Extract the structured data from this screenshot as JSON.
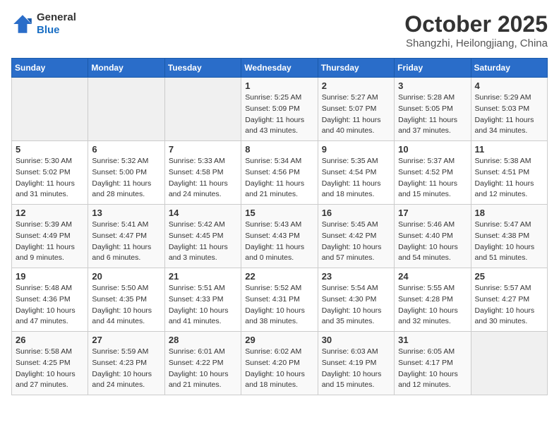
{
  "header": {
    "logo_line1": "General",
    "logo_line2": "Blue",
    "month": "October 2025",
    "location": "Shangzhi, Heilongjiang, China"
  },
  "weekdays": [
    "Sunday",
    "Monday",
    "Tuesday",
    "Wednesday",
    "Thursday",
    "Friday",
    "Saturday"
  ],
  "weeks": [
    [
      {
        "day": "",
        "info": ""
      },
      {
        "day": "",
        "info": ""
      },
      {
        "day": "",
        "info": ""
      },
      {
        "day": "1",
        "info": "Sunrise: 5:25 AM\nSunset: 5:09 PM\nDaylight: 11 hours\nand 43 minutes."
      },
      {
        "day": "2",
        "info": "Sunrise: 5:27 AM\nSunset: 5:07 PM\nDaylight: 11 hours\nand 40 minutes."
      },
      {
        "day": "3",
        "info": "Sunrise: 5:28 AM\nSunset: 5:05 PM\nDaylight: 11 hours\nand 37 minutes."
      },
      {
        "day": "4",
        "info": "Sunrise: 5:29 AM\nSunset: 5:03 PM\nDaylight: 11 hours\nand 34 minutes."
      }
    ],
    [
      {
        "day": "5",
        "info": "Sunrise: 5:30 AM\nSunset: 5:02 PM\nDaylight: 11 hours\nand 31 minutes."
      },
      {
        "day": "6",
        "info": "Sunrise: 5:32 AM\nSunset: 5:00 PM\nDaylight: 11 hours\nand 28 minutes."
      },
      {
        "day": "7",
        "info": "Sunrise: 5:33 AM\nSunset: 4:58 PM\nDaylight: 11 hours\nand 24 minutes."
      },
      {
        "day": "8",
        "info": "Sunrise: 5:34 AM\nSunset: 4:56 PM\nDaylight: 11 hours\nand 21 minutes."
      },
      {
        "day": "9",
        "info": "Sunrise: 5:35 AM\nSunset: 4:54 PM\nDaylight: 11 hours\nand 18 minutes."
      },
      {
        "day": "10",
        "info": "Sunrise: 5:37 AM\nSunset: 4:52 PM\nDaylight: 11 hours\nand 15 minutes."
      },
      {
        "day": "11",
        "info": "Sunrise: 5:38 AM\nSunset: 4:51 PM\nDaylight: 11 hours\nand 12 minutes."
      }
    ],
    [
      {
        "day": "12",
        "info": "Sunrise: 5:39 AM\nSunset: 4:49 PM\nDaylight: 11 hours\nand 9 minutes."
      },
      {
        "day": "13",
        "info": "Sunrise: 5:41 AM\nSunset: 4:47 PM\nDaylight: 11 hours\nand 6 minutes."
      },
      {
        "day": "14",
        "info": "Sunrise: 5:42 AM\nSunset: 4:45 PM\nDaylight: 11 hours\nand 3 minutes."
      },
      {
        "day": "15",
        "info": "Sunrise: 5:43 AM\nSunset: 4:43 PM\nDaylight: 11 hours\nand 0 minutes."
      },
      {
        "day": "16",
        "info": "Sunrise: 5:45 AM\nSunset: 4:42 PM\nDaylight: 10 hours\nand 57 minutes."
      },
      {
        "day": "17",
        "info": "Sunrise: 5:46 AM\nSunset: 4:40 PM\nDaylight: 10 hours\nand 54 minutes."
      },
      {
        "day": "18",
        "info": "Sunrise: 5:47 AM\nSunset: 4:38 PM\nDaylight: 10 hours\nand 51 minutes."
      }
    ],
    [
      {
        "day": "19",
        "info": "Sunrise: 5:48 AM\nSunset: 4:36 PM\nDaylight: 10 hours\nand 47 minutes."
      },
      {
        "day": "20",
        "info": "Sunrise: 5:50 AM\nSunset: 4:35 PM\nDaylight: 10 hours\nand 44 minutes."
      },
      {
        "day": "21",
        "info": "Sunrise: 5:51 AM\nSunset: 4:33 PM\nDaylight: 10 hours\nand 41 minutes."
      },
      {
        "day": "22",
        "info": "Sunrise: 5:52 AM\nSunset: 4:31 PM\nDaylight: 10 hours\nand 38 minutes."
      },
      {
        "day": "23",
        "info": "Sunrise: 5:54 AM\nSunset: 4:30 PM\nDaylight: 10 hours\nand 35 minutes."
      },
      {
        "day": "24",
        "info": "Sunrise: 5:55 AM\nSunset: 4:28 PM\nDaylight: 10 hours\nand 32 minutes."
      },
      {
        "day": "25",
        "info": "Sunrise: 5:57 AM\nSunset: 4:27 PM\nDaylight: 10 hours\nand 30 minutes."
      }
    ],
    [
      {
        "day": "26",
        "info": "Sunrise: 5:58 AM\nSunset: 4:25 PM\nDaylight: 10 hours\nand 27 minutes."
      },
      {
        "day": "27",
        "info": "Sunrise: 5:59 AM\nSunset: 4:23 PM\nDaylight: 10 hours\nand 24 minutes."
      },
      {
        "day": "28",
        "info": "Sunrise: 6:01 AM\nSunset: 4:22 PM\nDaylight: 10 hours\nand 21 minutes."
      },
      {
        "day": "29",
        "info": "Sunrise: 6:02 AM\nSunset: 4:20 PM\nDaylight: 10 hours\nand 18 minutes."
      },
      {
        "day": "30",
        "info": "Sunrise: 6:03 AM\nSunset: 4:19 PM\nDaylight: 10 hours\nand 15 minutes."
      },
      {
        "day": "31",
        "info": "Sunrise: 6:05 AM\nSunset: 4:17 PM\nDaylight: 10 hours\nand 12 minutes."
      },
      {
        "day": "",
        "info": ""
      }
    ]
  ]
}
